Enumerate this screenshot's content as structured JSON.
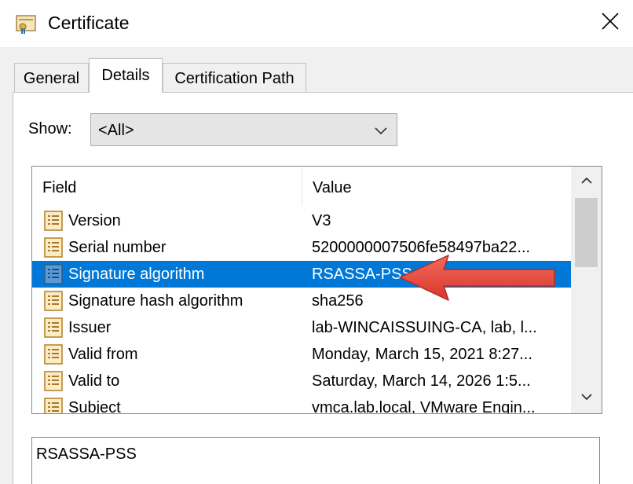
{
  "window": {
    "title": "Certificate",
    "icon": "certificate-icon",
    "close_icon": "close-icon"
  },
  "tabs": [
    {
      "label": "General",
      "active": false
    },
    {
      "label": "Details",
      "active": true
    },
    {
      "label": "Certification Path",
      "active": false
    }
  ],
  "show": {
    "label": "Show:",
    "selected": "<All>"
  },
  "list": {
    "columns": [
      "Field",
      "Value"
    ],
    "rows": [
      {
        "field": "Version",
        "value": "V3",
        "selected": false
      },
      {
        "field": "Serial number",
        "value": "5200000007506fe58497ba22...",
        "selected": false
      },
      {
        "field": "Signature algorithm",
        "value": "RSASSA-PSS",
        "selected": true
      },
      {
        "field": "Signature hash algorithm",
        "value": "sha256",
        "selected": false
      },
      {
        "field": "Issuer",
        "value": "lab-WINCAISSUING-CA, lab, l...",
        "selected": false
      },
      {
        "field": "Valid from",
        "value": "Monday, March 15, 2021 8:27...",
        "selected": false
      },
      {
        "field": "Valid to",
        "value": "Saturday, March 14, 2026 1:5...",
        "selected": false
      },
      {
        "field": "Subject",
        "value": "vmca.lab.local, VMware Engin...",
        "selected": false
      }
    ]
  },
  "detail_value": "RSASSA-PSS",
  "colors": {
    "selection": "#0078d7",
    "annotation_arrow": "#e8443a"
  }
}
